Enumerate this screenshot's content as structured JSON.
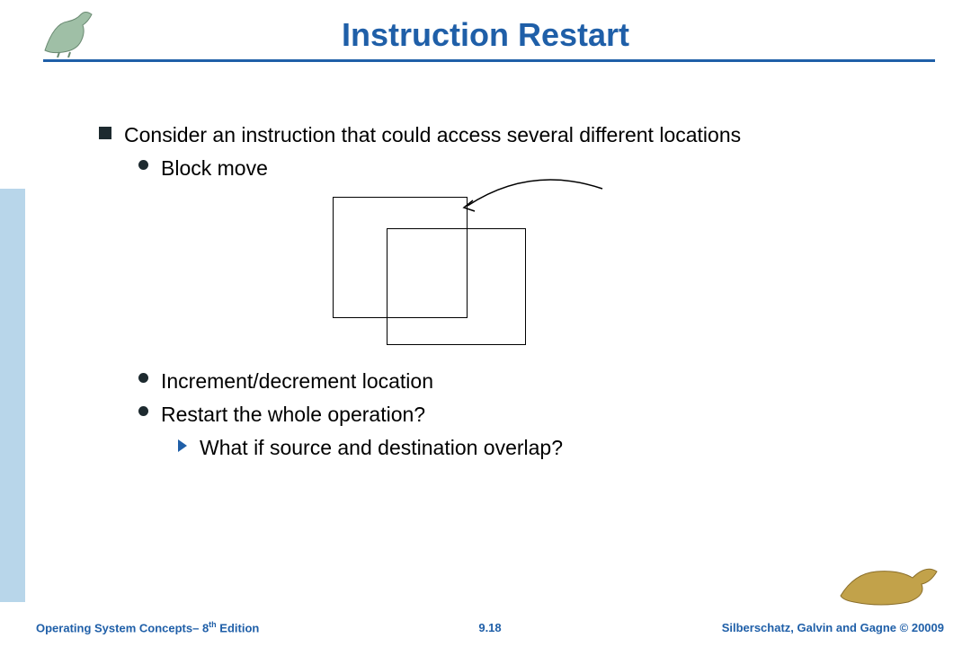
{
  "title": "Instruction Restart",
  "bullets": {
    "main": "Consider an instruction that could access several different locations",
    "sub": [
      "Block move",
      "Increment/decrement location",
      "Restart the whole operation?"
    ],
    "subsub": "What if source and destination overlap?"
  },
  "footer": {
    "left_a": "Operating System Concepts– 8",
    "left_b": " Edition",
    "left_sup": "th",
    "center": "9.18",
    "right": "Silberschatz, Galvin and Gagne © 20009"
  }
}
